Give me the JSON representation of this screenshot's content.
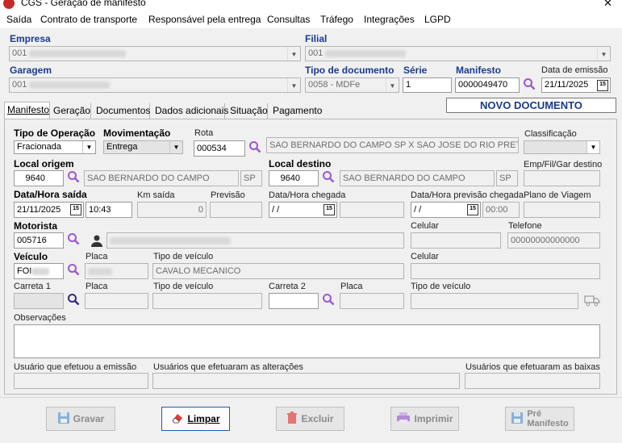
{
  "window": {
    "title": "CGS - Geração de manifesto",
    "close": "✕"
  },
  "menu": [
    "Saída",
    "Contrato de transporte",
    "Responsável pela entrega",
    "Consultas",
    "Tráfego",
    "Integrações",
    "LGPD"
  ],
  "header": {
    "empresa_label": "Empresa",
    "empresa_value": "001",
    "filial_label": "Filial",
    "filial_value": "001",
    "garagem_label": "Garagem",
    "garagem_value": "001",
    "tipo_doc_label": "Tipo de documento",
    "tipo_doc_value": "0058 - MDFe",
    "serie_label": "Série",
    "serie_value": "1",
    "manifesto_label": "Manifesto",
    "manifesto_value": "0000049470",
    "data_emissao_label": "Data de emissão",
    "data_emissao_value": "21/11/2025",
    "status": "NOVO DOCUMENTO"
  },
  "tabs": [
    "Manifesto",
    "Geração",
    "Documentos",
    "Dados adicionais",
    "Situação",
    "Pagamento"
  ],
  "form": {
    "tipo_operacao_label": "Tipo de Operação",
    "tipo_operacao_value": "Fracionada",
    "movimentacao_label": "Movimentação",
    "movimentacao_value": "Entrega",
    "rota_label": "Rota",
    "rota_value": "000534",
    "rota_desc": "SAO BERNARDO DO CAMPO SP X SAO JOSE DO RIO PRETO",
    "classificacao_label": "Classificação",
    "local_origem_label": "Local origem",
    "local_origem_value": "9640",
    "local_origem_desc": "SAO BERNARDO DO CAMPO",
    "local_origem_uf": "SP",
    "local_destino_label": "Local destino",
    "local_destino_value": "9640",
    "local_destino_desc": "SAO BERNARDO DO CAMPO",
    "local_destino_uf": "SP",
    "emp_fil_gar_label": "Emp/Fil/Gar destino",
    "data_saida_label": "Data/Hora saída",
    "data_saida_value": "21/11/2025",
    "hora_saida_value": "10:43",
    "km_saida_label": "Km saída",
    "km_saida_value": "0",
    "previsao_label": "Previsão",
    "data_chegada_label": "Data/Hora chegada",
    "data_chegada_value": " / /",
    "data_prev_chegada_label": "Data/Hora previsão chegada",
    "data_prev_chegada_value": " / /",
    "hora_prev_chegada_value": "00:00",
    "plano_viagem_label": "Plano de Viagem",
    "motorista_label": "Motorista",
    "motorista_value": "005716",
    "celular_label": "Celular",
    "telefone_label": "Telefone",
    "telefone_value": "00000000000000",
    "veiculo_label": "Veículo",
    "veiculo_value": "FOI",
    "placa_label": "Placa",
    "tipo_veiculo_label": "Tipo de veículo",
    "tipo_veiculo_value": "CAVALO MECANICO",
    "celular2_label": "Celular",
    "carreta1_label": "Carreta 1",
    "placa2_label": "Placa",
    "tipo_veiculo2_label": "Tipo de veículo",
    "carreta2_label": "Carreta 2",
    "placa3_label": "Placa",
    "tipo_veiculo3_label": "Tipo de veículo",
    "observacoes_label": "Observações",
    "usuario_emissao_label": "Usuário que efetuou a emissão",
    "usuarios_alteracoes_label": "Usuários que efetuaram as alterações",
    "usuarios_baixas_label": "Usuários que efetuaram as baixas"
  },
  "buttons": {
    "gravar": "Gravar",
    "limpar": "Limpar",
    "excluir": "Excluir",
    "imprimir": "Imprimir",
    "pre1": "Pré",
    "pre2": "Manifesto"
  },
  "colors": {
    "accent": "#1a3a8a",
    "search": "#9b59d0",
    "status_text": "#1a3a8a"
  }
}
